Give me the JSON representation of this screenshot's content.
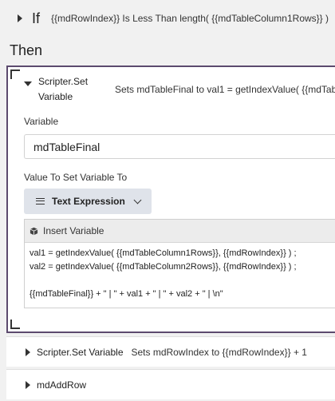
{
  "if_row": {
    "keyword": "If",
    "condition": "{{mdRowIndex}} Is Less Than length( {{mdTableColumn1Rows}} )"
  },
  "then_label": "Then",
  "set_block": {
    "title": "Scripter.Set Variable",
    "summary": "Sets mdTableFinal to val1 = getIndexValue( {{mdTab",
    "variable_label": "Variable",
    "variable_value": "mdTableFinal",
    "value_label": "Value To Set Variable To",
    "expression_type": "Text Expression",
    "insert_variable_label": "Insert Variable",
    "code_lines": [
      "val1 = getIndexValue( {{mdTableColumn1Rows}}, {{mdRowIndex}} ) ;",
      "val2 = getIndexValue( {{mdTableColumn2Rows}}, {{mdRowIndex}} ) ;",
      "",
      "{{mdTableFinal}} + \" | \" + val1 + \" | \" + val2 + \"  | \\n\""
    ]
  },
  "rows": [
    {
      "title": "Scripter.Set Variable",
      "summary": "Sets mdRowIndex to {{mdRowIndex}} + 1"
    },
    {
      "title": "mdAddRow",
      "summary": ""
    }
  ]
}
